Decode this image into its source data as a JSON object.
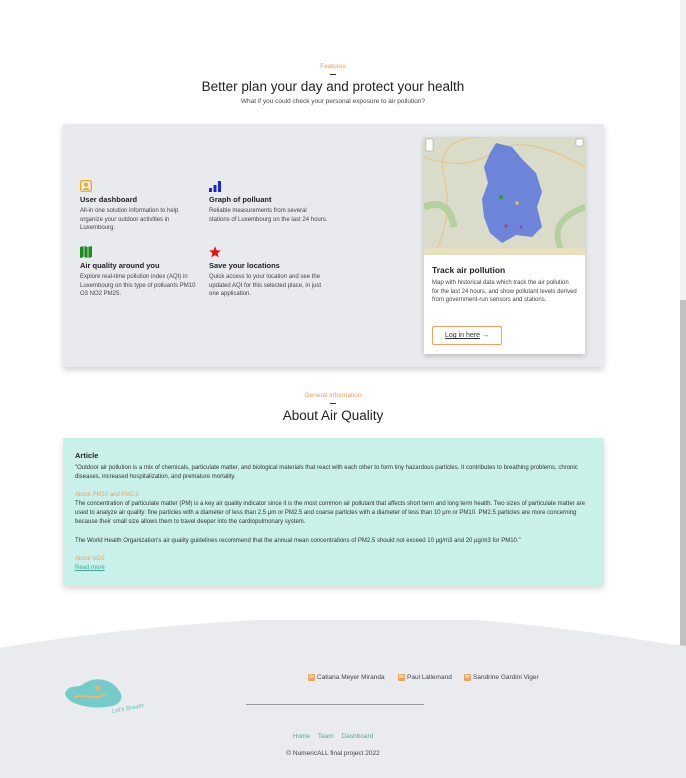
{
  "features": {
    "eyebrow": "Features",
    "title": "Better plan your day and protect your health",
    "subtitle": "What if you could check your personal exposure to air pollution?",
    "items": [
      {
        "title": "User dashboard",
        "text": "All-in one solution information to help organize your outdoor activities in Luxembourg.",
        "icon": "user-dashboard-icon",
        "color": "#f0a500"
      },
      {
        "title": "Graph of polluant",
        "text": "Reliable measurements from several stations of Luxembourg on the last 24 hours.",
        "icon": "bar-chart-icon",
        "color": "#1a25d6"
      },
      {
        "title": "Air quality around you",
        "text": "Explore real-time pollution index (AQI) in Luxembourg on this type of polluants PM10 O3 NO2 PM25.",
        "icon": "map-icon",
        "color": "#1c8c1c"
      },
      {
        "title": "Save your locations",
        "text": "Quick access to your location and see the updated AQI for this selected place, in just one application.",
        "icon": "star-icon",
        "color": "#e81212"
      }
    ],
    "map_card": {
      "title": "Track air pollution",
      "text": "Map with historical data which track the air pollution for the last 24 hours, and show pollutant levels derived from government-run sensors and stations.",
      "button_label": "Log in here",
      "button_arrow": "→"
    }
  },
  "about": {
    "eyebrow": "General information",
    "title": "About Air Quality",
    "article": {
      "heading": "Article",
      "intro": "\"Outdoor air pollution is a mix of chemicals, particulate matter, and biological materials that react with each other to form tiny hazardous particles. It contributes to breathing problems, chronic diseases, increased hospitalization, and premature mortality.",
      "pm_heading": "About PM10 and PM2.5",
      "pm_text": "The concentration of particulate matter (PM) is a key air quality indicator since it is the most common air pollutant that affects short term and long term health. Two sizes of particulate matter are used to analyze air quality: fine particles with a diameter of less than 2.5 µm or PM2.5 and coarse particles with a diameter of less than 10 µm or PM10. PM2.5 particles are more concerning because their small size allows them to travel deeper into the cardiopulmonary system.",
      "who_text": "The World Health Organization's air quality guidelines recommend that the annual mean concentrations of PM2.5 should not exceed 10 µg/m3 and 20 µg/m3 for PM10.\"",
      "no2_heading": "About NO2",
      "read_more": "Read more"
    }
  },
  "footer": {
    "authors": [
      "Catiana Meyer Miranda",
      "Paul Lallemand",
      "Sandrine Gardini Viger"
    ],
    "logo_text": "Let's Breathe",
    "links": [
      "Home",
      "Team",
      "Dashboard"
    ],
    "copyright": "© NumericALL final project 2022",
    "accent": "#f0a15b",
    "link_color": "#5aa89b"
  }
}
